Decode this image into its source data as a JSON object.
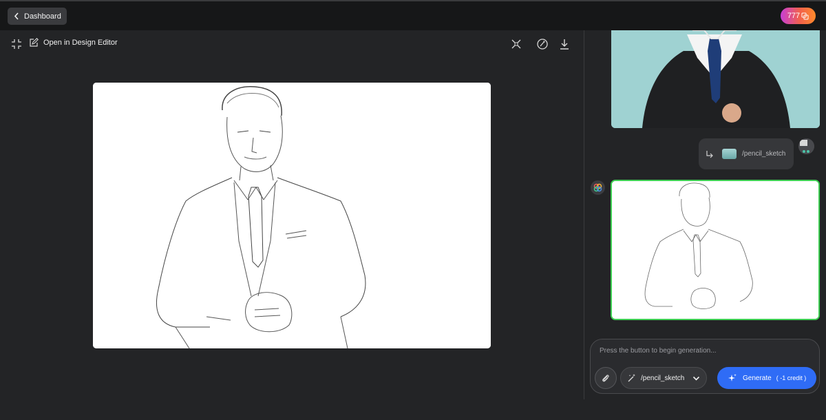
{
  "header": {
    "back_label": "Dashboard",
    "credits": "777"
  },
  "toolbar": {
    "open_editor_label": "Open in Design Editor"
  },
  "chat": {
    "command": "/pencil_sketch"
  },
  "composer": {
    "placeholder": "Press the button to begin generation...",
    "preset": "/pencil_sketch",
    "generate_label": "Generate",
    "generate_cost": "( -1 credit )"
  },
  "colors": {
    "accent": "#2f6cf6",
    "result_border": "#3ecf53"
  }
}
